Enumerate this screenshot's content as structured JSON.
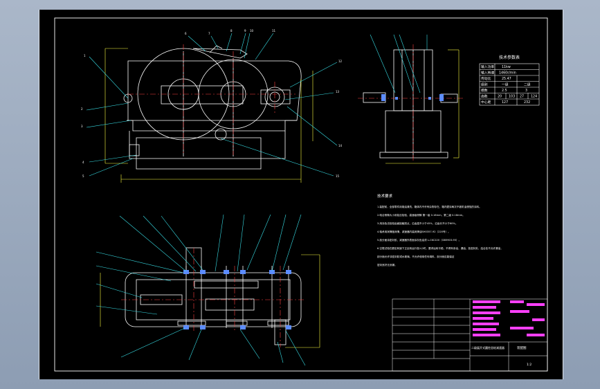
{
  "tech_params": {
    "title": "技术参数表",
    "rows": [
      {
        "label": "输入功率",
        "value": "11kw"
      },
      {
        "label": "输入转速",
        "value": "1460r/min"
      },
      {
        "label": "传动比",
        "value": "25.47"
      },
      {
        "label": "级别",
        "c1": "一级",
        "c2": "二级"
      },
      {
        "label": "模数",
        "c1": "2.5",
        "c2": "3"
      },
      {
        "label": "齿数",
        "c1": "20",
        "c2": "103",
        "c3": "27",
        "c4": "124"
      },
      {
        "label": "中心距",
        "c1": "127",
        "c2": "232"
      }
    ]
  },
  "tech_requirements": {
    "title": "技术要求",
    "items": [
      "1.装配前，全部零件用煤油清洗，箱体内不许有杂物存在，箱内壁涂两次不被机油侵蚀的涂料。",
      "2.啮合侧隙大小用铅丝检验，高速级侧隙 第一级 0.16mm，第二级 0.18mm。",
      "3.用涂色法检验齿面接触斑点，沿齿高不小于45%，沿齿长不小于60%。",
      "4.轴承用润滑脂润滑，减速器内装润滑油SH0357-92（220号）。",
      "5.剖分面涂密封胶，减速器外表面涂灰色油漆 L-CKC220（GB5903-95）。",
      "6.空载试验在额定转速下正反转运行各1小时，要求运转平稳，不得有渗油、漏油，各密封处、结合处不允许漏油，",
      "剖分面允许涂密封胶或水玻璃，不允许使用任何填料，剖分面应能保证",
      "密封良好无渗漏。"
    ]
  },
  "title_block": {
    "name": "二级展开式圆柱齿轮减速器",
    "drawing_no": "装配图",
    "scale": "1:2"
  },
  "colors": {
    "sheet": "#000000",
    "outline": "#ffffff",
    "leader": "#38e0e8",
    "center": "#ff4040",
    "dimension": "#ffff40",
    "highlight": "#ff40ff",
    "section": "#5c8cff"
  },
  "icons": {
    "bolt": "bolt-section-icon",
    "bearing": "bearing-section-icon"
  }
}
